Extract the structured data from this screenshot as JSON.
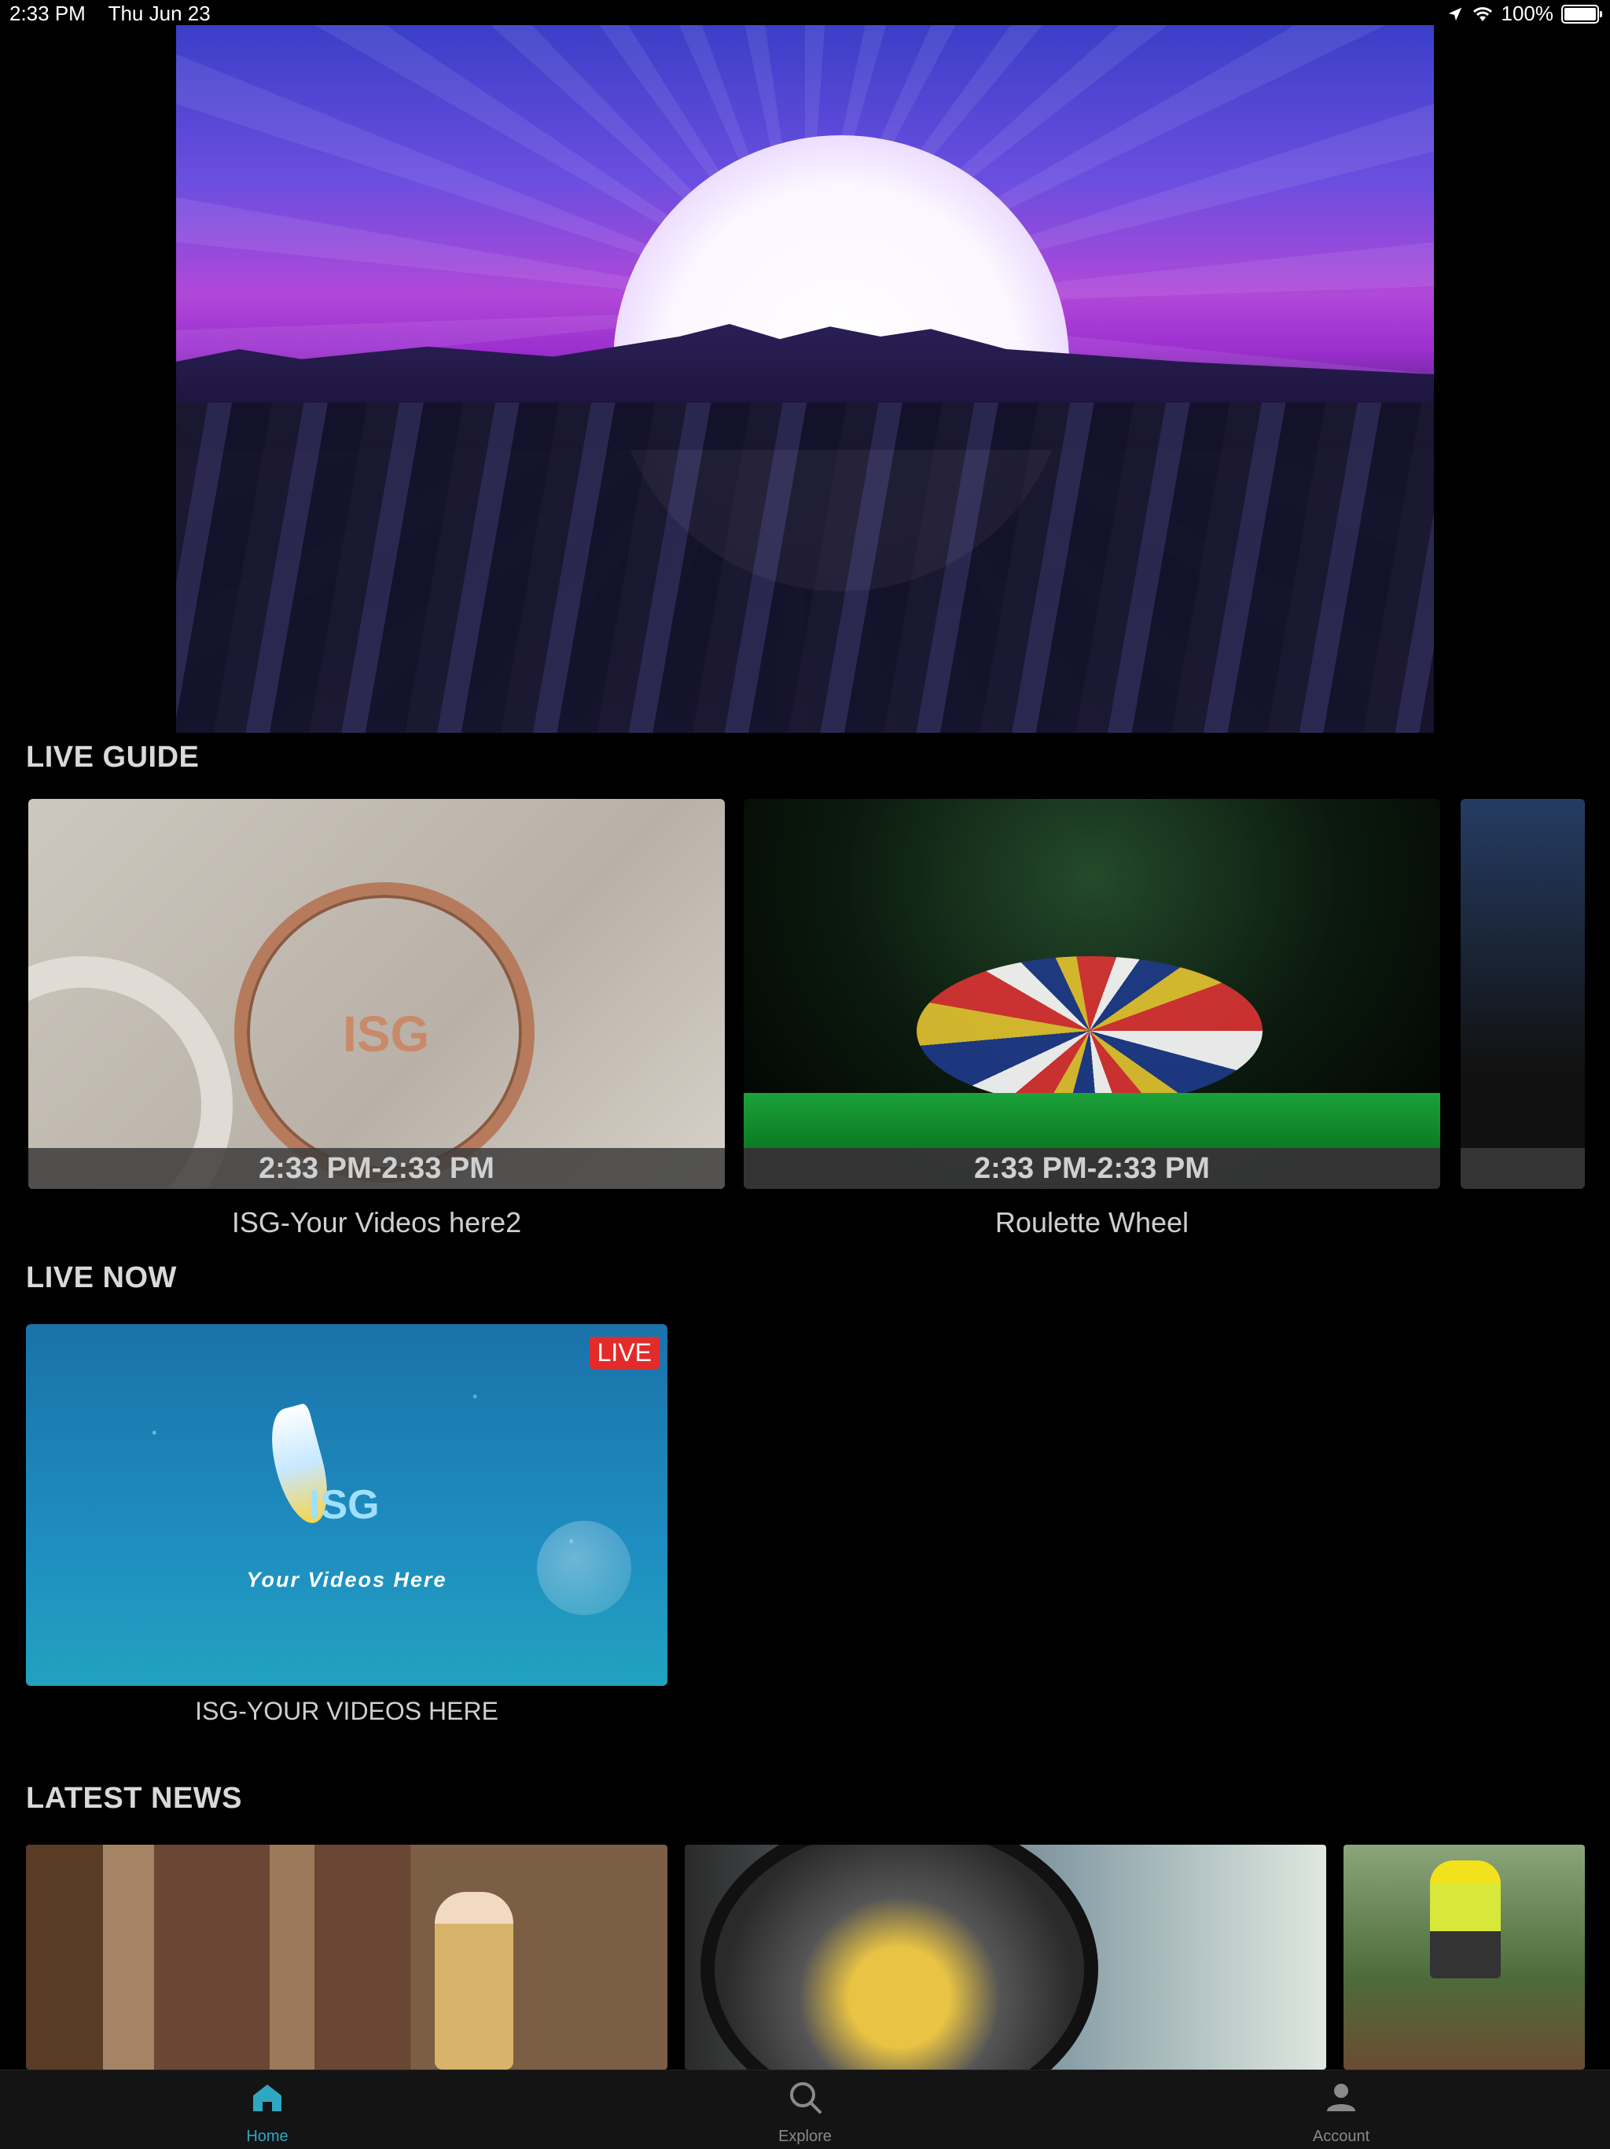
{
  "status_bar": {
    "time": "2:33 PM",
    "date": "Thu Jun 23",
    "battery": "100%"
  },
  "sections": {
    "live_guide": "LIVE GUIDE",
    "live_now": "LIVE NOW",
    "latest_news": "LATEST NEWS"
  },
  "live_guide": [
    {
      "time": "2:33 PM-2:33 PM",
      "title": "ISG-Your Videos here2"
    },
    {
      "time": "2:33 PM-2:33 PM",
      "title": "Roulette Wheel"
    }
  ],
  "live_now": {
    "badge": "LIVE",
    "title": "ISG-YOUR VIDEOS HERE",
    "thumb_brand": "ISG",
    "thumb_tagline": "Your Videos Here"
  },
  "guide_thumb_logo": "ISG",
  "tab_bar": {
    "tabs": [
      {
        "label": "Home",
        "icon": "home-icon",
        "active": true
      },
      {
        "label": "Explore",
        "icon": "search-icon",
        "active": false
      },
      {
        "label": "Account",
        "icon": "person-icon",
        "active": false
      }
    ],
    "active_color": "#2ea7c2",
    "inactive_color": "#8a8a8a"
  },
  "colors": {
    "live_badge": "#e32b2b",
    "background": "#000000",
    "section_title": "#d9d9d9"
  }
}
